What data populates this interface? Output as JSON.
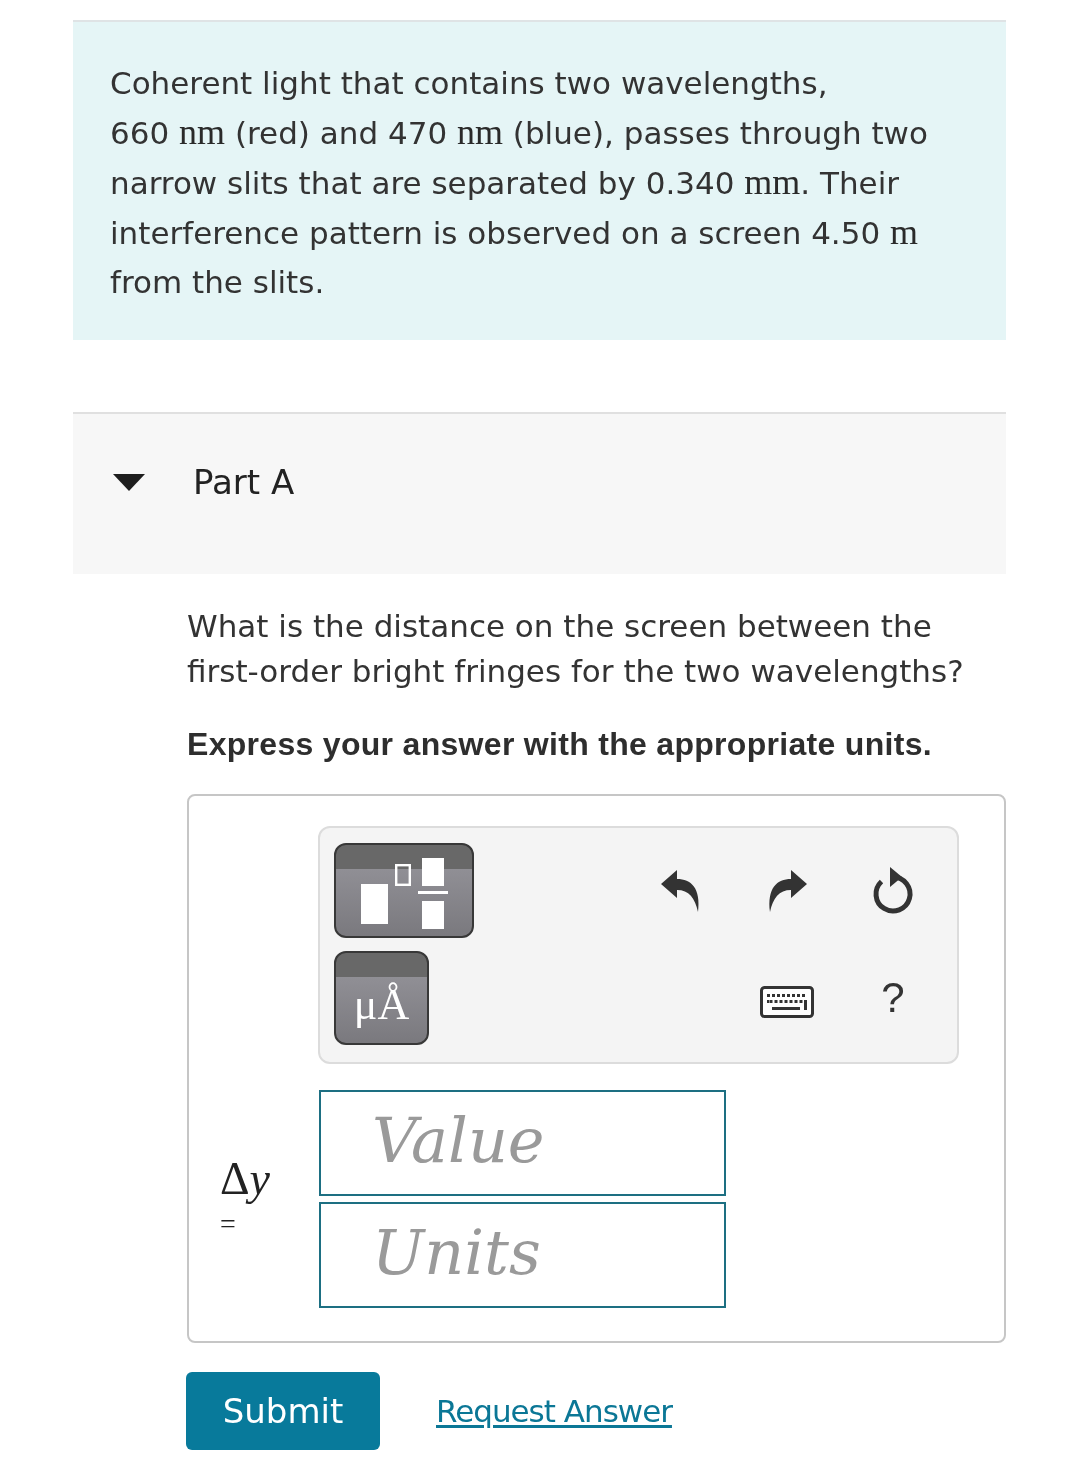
{
  "problem": {
    "segments": [
      {
        "kind": "text",
        "text": "Coherent light that contains two wavelengths, "
      },
      {
        "kind": "quantity",
        "number": "660",
        "unit": "nm"
      },
      {
        "kind": "text",
        "text": " (red) and "
      },
      {
        "kind": "quantity",
        "number": "470",
        "unit": "nm"
      },
      {
        "kind": "text",
        "text": " (blue), passes through two narrow slits that are separated by "
      },
      {
        "kind": "quantity",
        "number": "0.340",
        "unit": "mm"
      },
      {
        "kind": "text",
        "text": ". Their interference pattern is observed on a screen "
      },
      {
        "kind": "quantity",
        "number": "4.50",
        "unit": "m"
      },
      {
        "kind": "text",
        "text": " from the slits."
      }
    ]
  },
  "part": {
    "title": "Part A",
    "expanded": true
  },
  "question": {
    "prompt": "What is the distance on the screen between the first-order bright fringes for the two wavelengths?",
    "instruction": "Express your answer with the appropriate units."
  },
  "answer": {
    "toolbar": {
      "units_button": "μÅ",
      "help": "?"
    },
    "variable": {
      "operator": "Δ",
      "symbol": "y"
    },
    "equals": "=",
    "fields": [
      {
        "placeholder": "Value"
      },
      {
        "placeholder": "Units"
      }
    ]
  },
  "actions": [
    {
      "kind": "button",
      "label": "Submit"
    },
    {
      "kind": "link",
      "label": "Request Answer"
    }
  ]
}
